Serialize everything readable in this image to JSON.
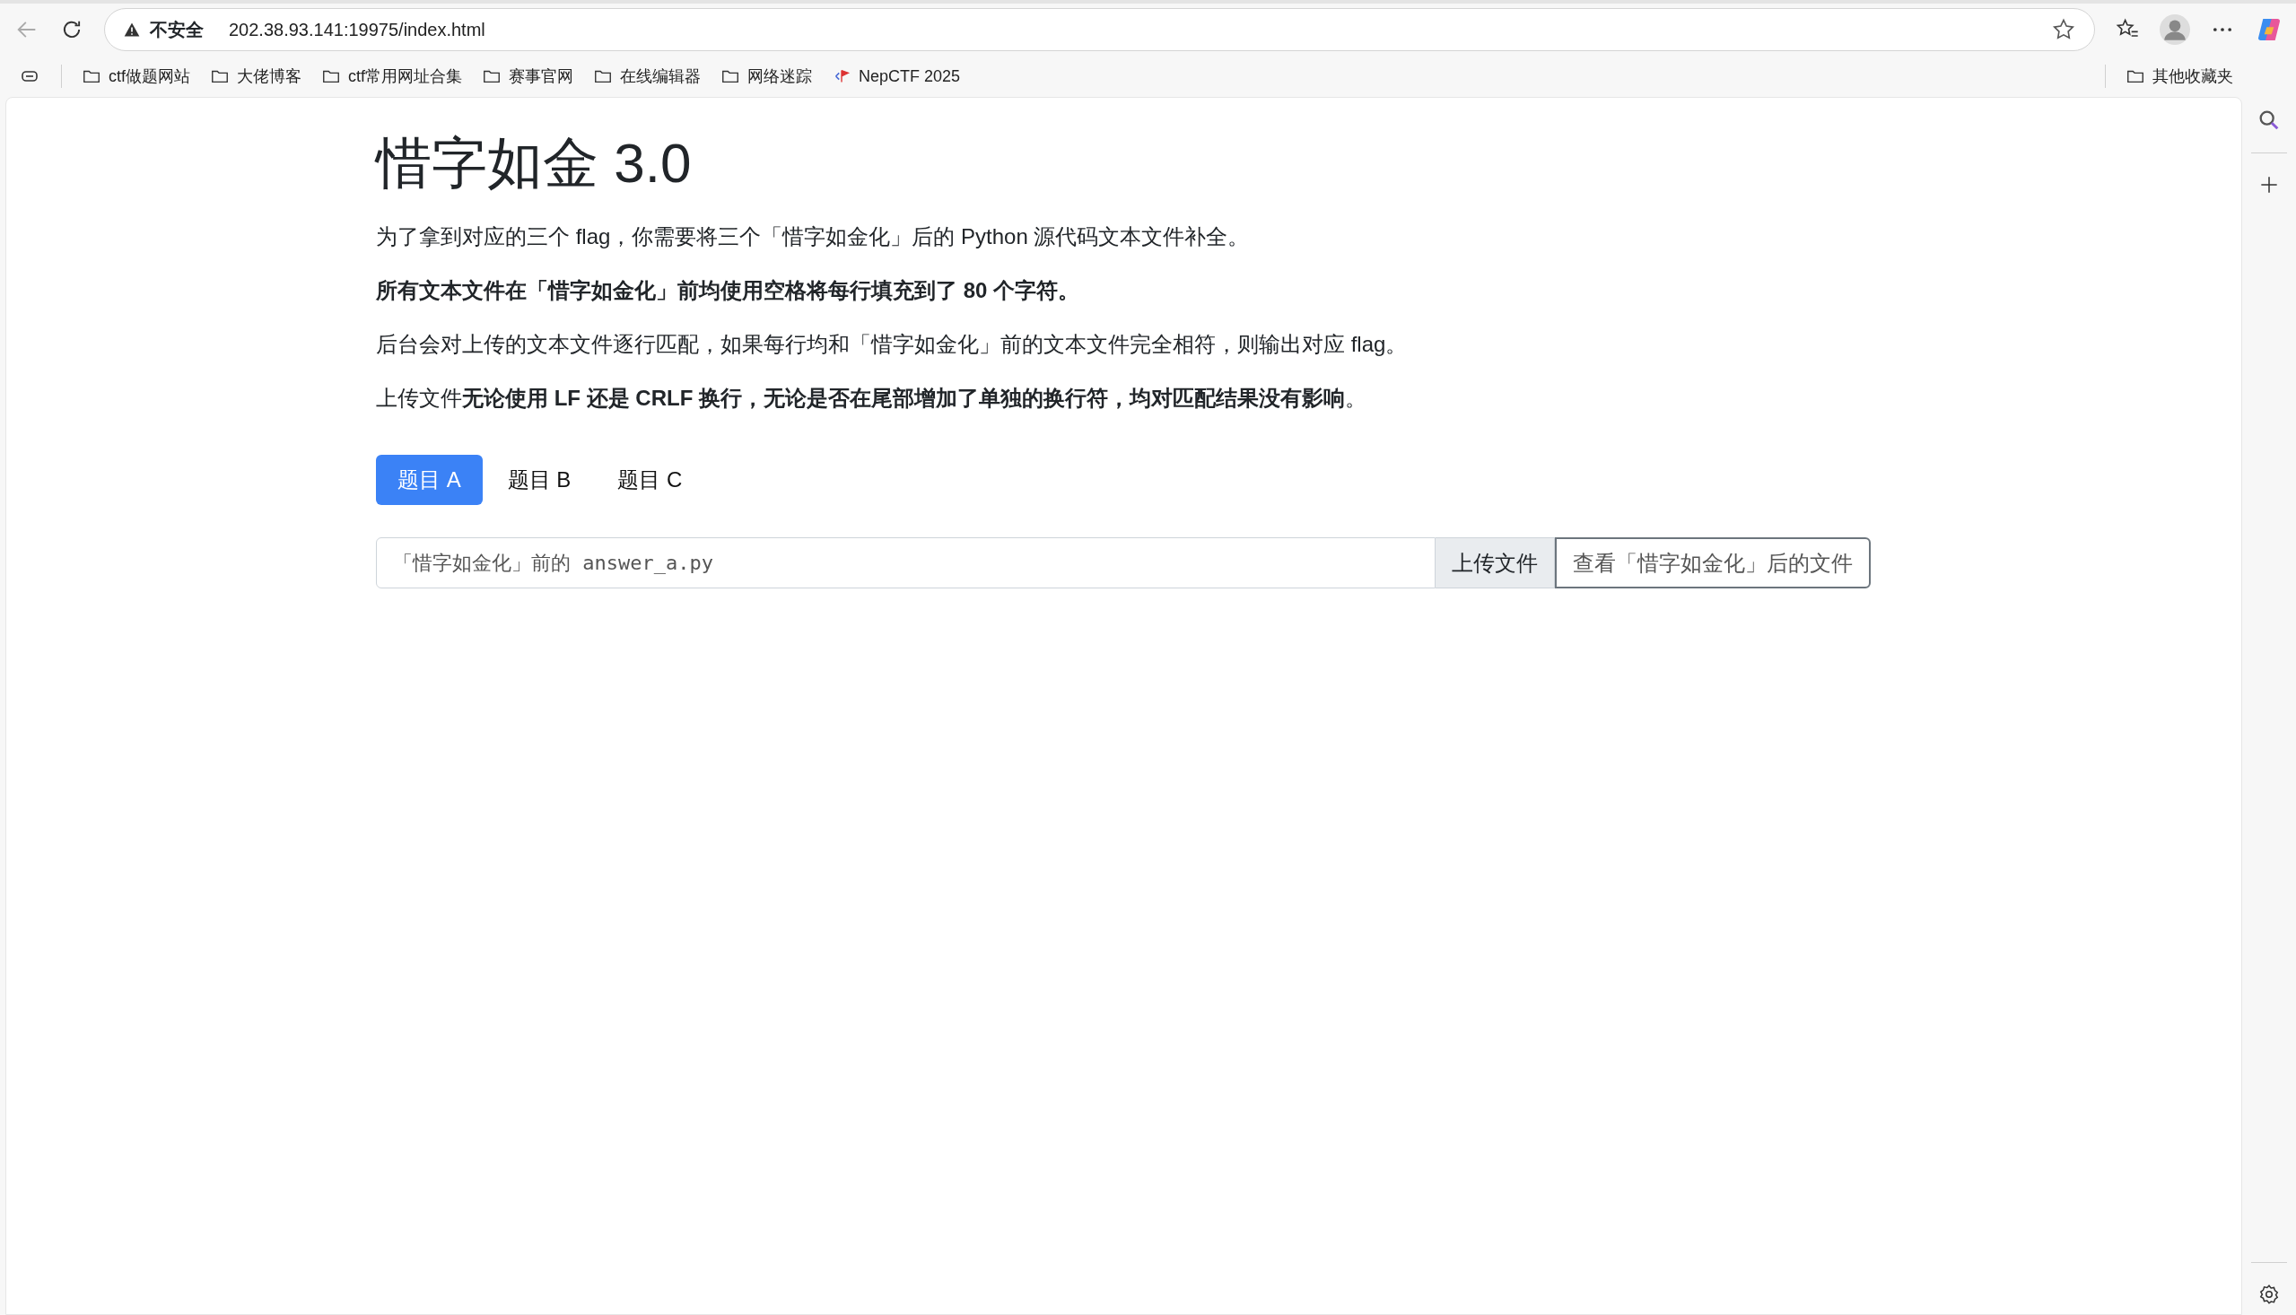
{
  "browser": {
    "security_label": "不安全",
    "url": "202.38.93.141:19975/index.html",
    "bookmarks": [
      {
        "label": "ctf做题网站",
        "kind": "folder"
      },
      {
        "label": "大佬博客",
        "kind": "folder"
      },
      {
        "label": "ctf常用网址合集",
        "kind": "folder"
      },
      {
        "label": "赛事官网",
        "kind": "folder"
      },
      {
        "label": "在线编辑器",
        "kind": "folder"
      },
      {
        "label": "网络迷踪",
        "kind": "folder"
      },
      {
        "label": "NepCTF 2025",
        "kind": "site"
      }
    ],
    "other_bookmarks": "其他收藏夹"
  },
  "page": {
    "title": "惜字如金 3.0",
    "paragraphs": [
      {
        "text": "为了拿到对应的三个 flag，你需要将三个「惜字如金化」后的 Python 源代码文本文件补全。",
        "kind": "plain"
      },
      {
        "text": "所有文本文件在「惜字如金化」前均使用空格将每行填充到了 80 个字符。",
        "kind": "strong"
      },
      {
        "text": "后台会对上传的文本文件逐行匹配，如果每行均和「惜字如金化」前的文本文件完全相符，则输出对应 flag。",
        "kind": "plain"
      },
      {
        "text": "上传文件**无论使用 LF 还是 CRLF 换行，无论是否在尾部增加了单独的换行符，均对匹配结果没有影响**。",
        "kind": "plain"
      }
    ],
    "tabs": [
      {
        "label": "题目 A",
        "selected": true
      },
      {
        "label": "题目 B",
        "selected": false
      },
      {
        "label": "题目 C",
        "selected": false
      }
    ],
    "file_field": {
      "placeholder": "「惜字如金化」前的 answer_a.py"
    },
    "upload_label": "上传文件",
    "view_button": "查看「惜字如金化」后的文件"
  }
}
